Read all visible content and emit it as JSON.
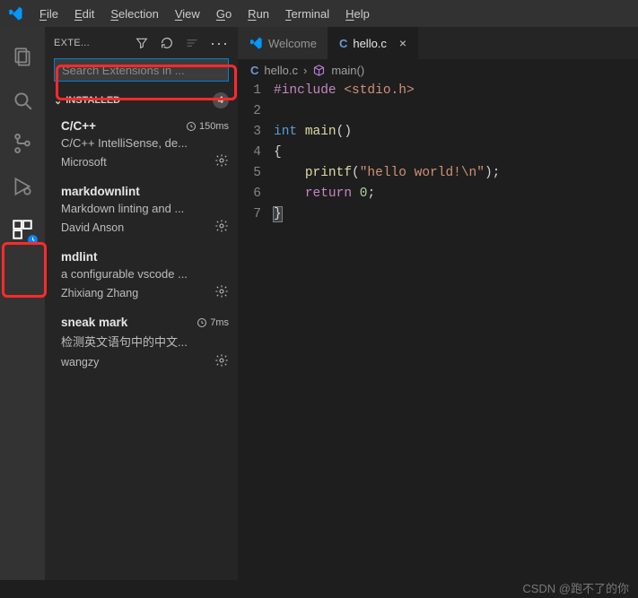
{
  "menu": {
    "items": [
      {
        "label": "File",
        "u": 0
      },
      {
        "label": "Edit",
        "u": 0
      },
      {
        "label": "Selection",
        "u": 0
      },
      {
        "label": "View",
        "u": 0
      },
      {
        "label": "Go",
        "u": 0
      },
      {
        "label": "Run",
        "u": 0
      },
      {
        "label": "Terminal",
        "u": 0
      },
      {
        "label": "Help",
        "u": 0
      }
    ]
  },
  "activity": {
    "items": [
      "explorer",
      "search",
      "scm",
      "run",
      "extensions"
    ]
  },
  "sidebar": {
    "title": "EXTE...",
    "search_placeholder": "Search Extensions in ...",
    "section_label": "INSTALLED",
    "count": "4",
    "ext": [
      {
        "name": "C/C++",
        "time": "150ms",
        "desc": "C/C++ IntelliSense, de...",
        "pub": "Microsoft",
        "show_time": true
      },
      {
        "name": "markdownlint",
        "time": "",
        "desc": "Markdown linting and ...",
        "pub": "David Anson",
        "show_time": false
      },
      {
        "name": "mdlint",
        "time": "",
        "desc": "a configurable vscode ...",
        "pub": "Zhixiang Zhang",
        "show_time": false
      },
      {
        "name": "sneak mark",
        "time": "7ms",
        "desc": "检测英文语句中的中文...",
        "pub": "wangzy",
        "show_time": true
      }
    ]
  },
  "tabs": {
    "items": [
      {
        "label": "Welcome",
        "icon": "vscode",
        "active": false,
        "close": false
      },
      {
        "label": "hello.c",
        "icon": "c",
        "active": true,
        "close": true,
        "prefix": "C"
      }
    ]
  },
  "breadcrumbs": {
    "file_prefix": "C",
    "file": "hello.c",
    "symbol": "main()"
  },
  "code": {
    "lines": [
      {
        "n": "1",
        "html": "<span class='tok-kw'>#include</span> <span class='tok-inc'>&lt;stdio.h&gt;</span>"
      },
      {
        "n": "2",
        "html": ""
      },
      {
        "n": "3",
        "html": "<span class='tok-kw2'>int</span> <span class='tok-fn'>main</span>()"
      },
      {
        "n": "4",
        "html": "<span>{</span>"
      },
      {
        "n": "5",
        "html": "    <span class='tok-fn'>printf</span>(<span class='tok-str'>\"hello world!\\n\"</span>);"
      },
      {
        "n": "6",
        "html": "    <span class='tok-kw'>return</span> <span class='tok-num'>0</span>;"
      },
      {
        "n": "7",
        "html": "<span class='sel-br'>}</span>"
      }
    ]
  },
  "watermark": "CSDN @跑不了的你"
}
